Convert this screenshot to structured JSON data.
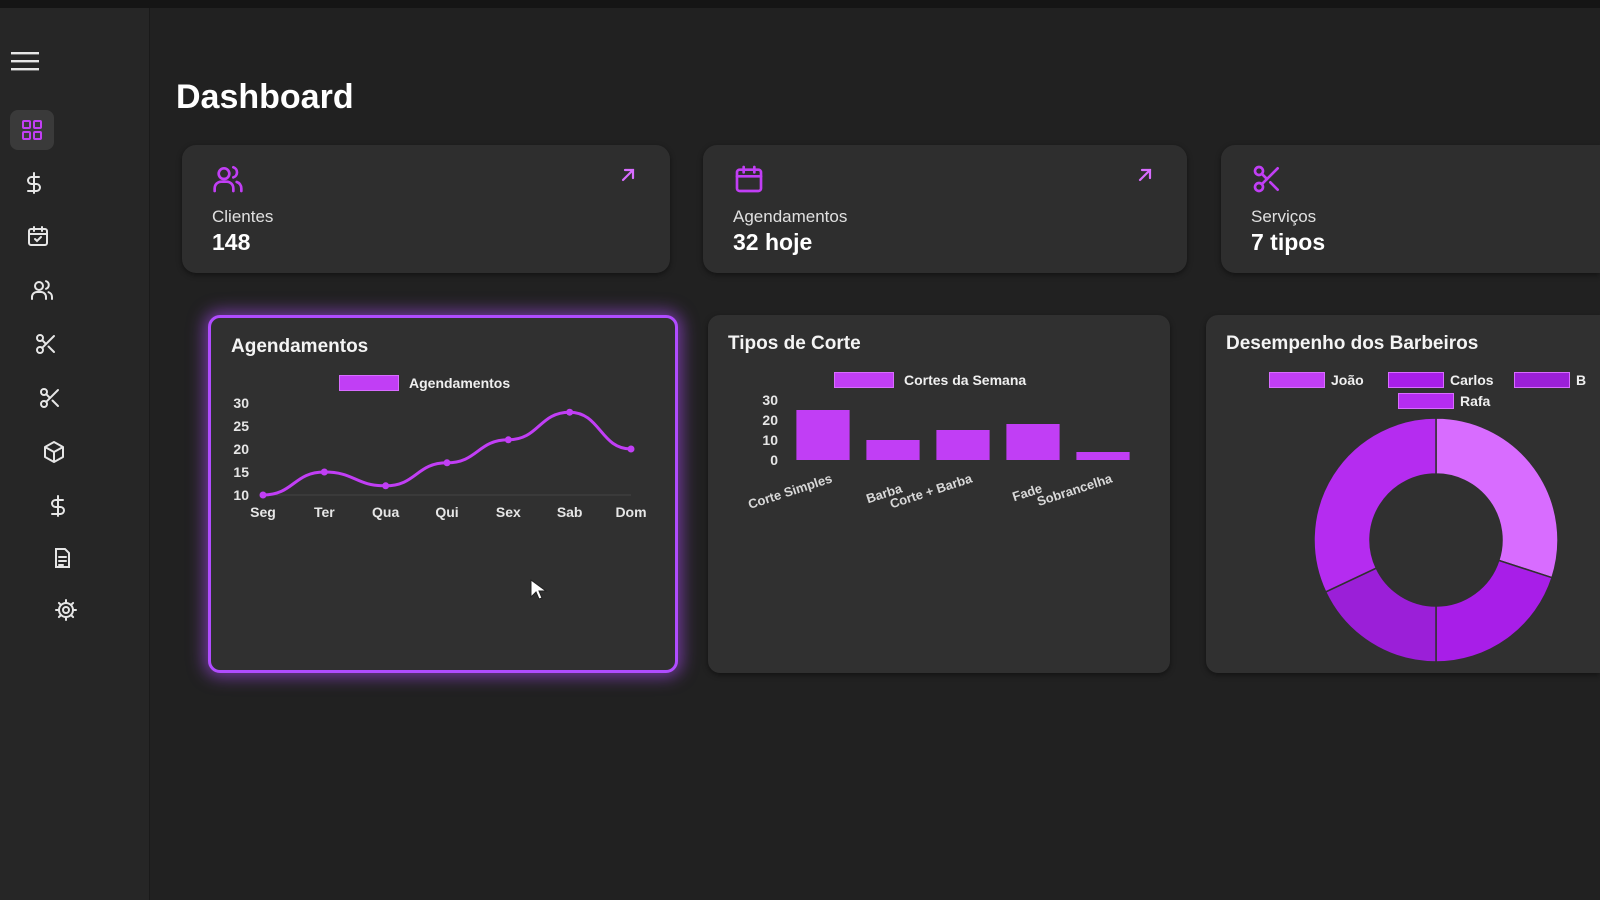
{
  "page": {
    "title": "Dashboard"
  },
  "colors": {
    "accent": "#c13ef5",
    "accent_light": "#d86cff",
    "accent_dark": "#9b1fd8",
    "card": "#2e2e2e",
    "background": "#212121"
  },
  "sidebar": {
    "items": [
      {
        "icon": "dashboard-grid-icon"
      },
      {
        "icon": "dollar-icon"
      },
      {
        "icon": "calendar-icon"
      },
      {
        "icon": "users-icon"
      },
      {
        "icon": "scissors-icon"
      },
      {
        "icon": "scissors-icon"
      },
      {
        "icon": "box-icon"
      },
      {
        "icon": "dollar-icon"
      },
      {
        "icon": "document-icon"
      },
      {
        "icon": "gear-icon"
      }
    ]
  },
  "stats": [
    {
      "label": "Clientes",
      "value": "148",
      "icon": "users-icon"
    },
    {
      "label": "Agendamentos",
      "value": "32 hoje",
      "icon": "calendar-icon"
    },
    {
      "label": "Serviços",
      "value": "7 tipos",
      "icon": "scissors-icon"
    }
  ],
  "charts": {
    "appointments": {
      "title": "Agendamentos",
      "legend": "Agendamentos"
    },
    "cuts": {
      "title": "Tipos de Corte",
      "legend": "Cortes da Semana"
    },
    "barbers": {
      "title": "Desempenho dos Barbeiros",
      "legend": [
        "João",
        "Carlos",
        "B",
        "Rafa"
      ]
    }
  },
  "chart_data": [
    {
      "type": "line",
      "title": "Agendamentos",
      "categories": [
        "Seg",
        "Ter",
        "Qua",
        "Qui",
        "Sex",
        "Sab",
        "Dom"
      ],
      "series": [
        {
          "name": "Agendamentos",
          "values": [
            10,
            15,
            12,
            17,
            22,
            28,
            20
          ]
        }
      ],
      "y_ticks": [
        10,
        15,
        20,
        25,
        30
      ],
      "ylim": [
        10,
        30
      ],
      "legend": "top"
    },
    {
      "type": "bar",
      "title": "Tipos de Corte",
      "categories": [
        "Corte Simples",
        "Barba",
        "Corte + Barba",
        "Fade",
        "Sobrancelha"
      ],
      "series": [
        {
          "name": "Cortes da Semana",
          "values": [
            25,
            10,
            15,
            18,
            4
          ]
        }
      ],
      "y_ticks": [
        0,
        10,
        20,
        30
      ],
      "ylim": [
        0,
        30
      ],
      "legend": "top"
    },
    {
      "type": "pie",
      "title": "Desempenho dos Barbeiros",
      "variant": "doughnut",
      "labels": [
        "João",
        "Carlos",
        "B",
        "Rafa"
      ],
      "values": [
        30,
        20,
        18,
        32
      ],
      "legend": "top"
    }
  ]
}
